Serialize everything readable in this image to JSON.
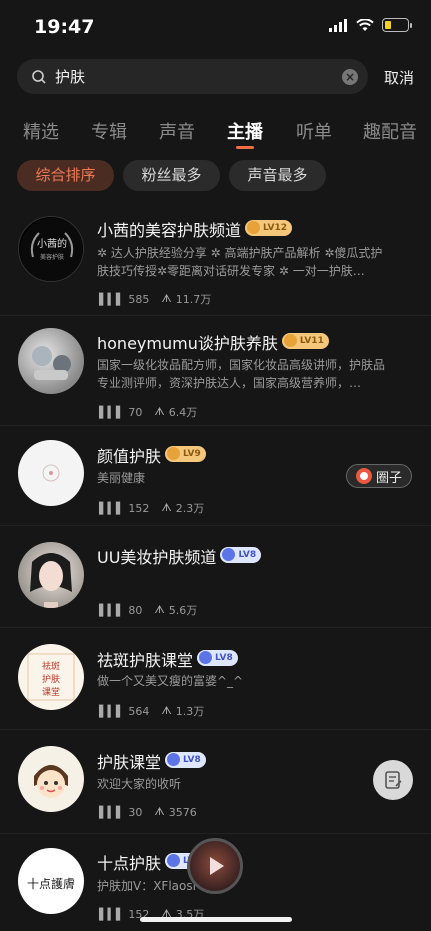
{
  "status": {
    "time": "19:47"
  },
  "search": {
    "query": "护肤",
    "cancel": "取消"
  },
  "tabs": [
    "精选",
    "专辑",
    "声音",
    "主播",
    "听单",
    "趣配音"
  ],
  "active_tab": "主播",
  "sort": [
    "综合排序",
    "粉丝最多",
    "声音最多"
  ],
  "anchors": [
    {
      "name": "小茜的美容护肤频道",
      "level": "LV12",
      "desc": "✲ 达人护肤经验分享 ✲ 高端护肤产品解析 ✲傻瓜式护肤技巧传授✲零距离对话研发专家 ✲ 一对一护肤…",
      "tracks": "585",
      "fans": "11.7万",
      "avatar_text": "小茜的\n美容护肤"
    },
    {
      "name": "honeymumu谈护肤养肤",
      "level": "LV11",
      "desc": "国家一级化妆品配方师，国家化妆品高级讲师，护肤品专业测评师，资深护肤达人，国家高级营养师，…",
      "tracks": "70",
      "fans": "6.4万"
    },
    {
      "name": "颜值护肤",
      "level": "LV9",
      "desc": "美丽健康",
      "tracks": "152",
      "fans": "2.3万",
      "circle": "圈子"
    },
    {
      "name": "UU美妆护肤频道",
      "level": "LV8",
      "desc": "",
      "tracks": "80",
      "fans": "5.6万"
    },
    {
      "name": "祛斑护肤课堂",
      "level": "LV8",
      "desc": "做一个又美又瘦的富婆^_^",
      "tracks": "564",
      "fans": "1.3万",
      "avatar_text": "祛斑\n护肤\n课堂"
    },
    {
      "name": "护肤课堂",
      "level": "LV8",
      "desc": "欢迎大家的收听",
      "tracks": "30",
      "fans": "3576"
    },
    {
      "name": "十点护肤",
      "level": "LV8",
      "desc": "护肤加V：XFlaosi",
      "tracks": "152",
      "fans": "3.5万",
      "avatar_text": "十点護膚"
    }
  ]
}
